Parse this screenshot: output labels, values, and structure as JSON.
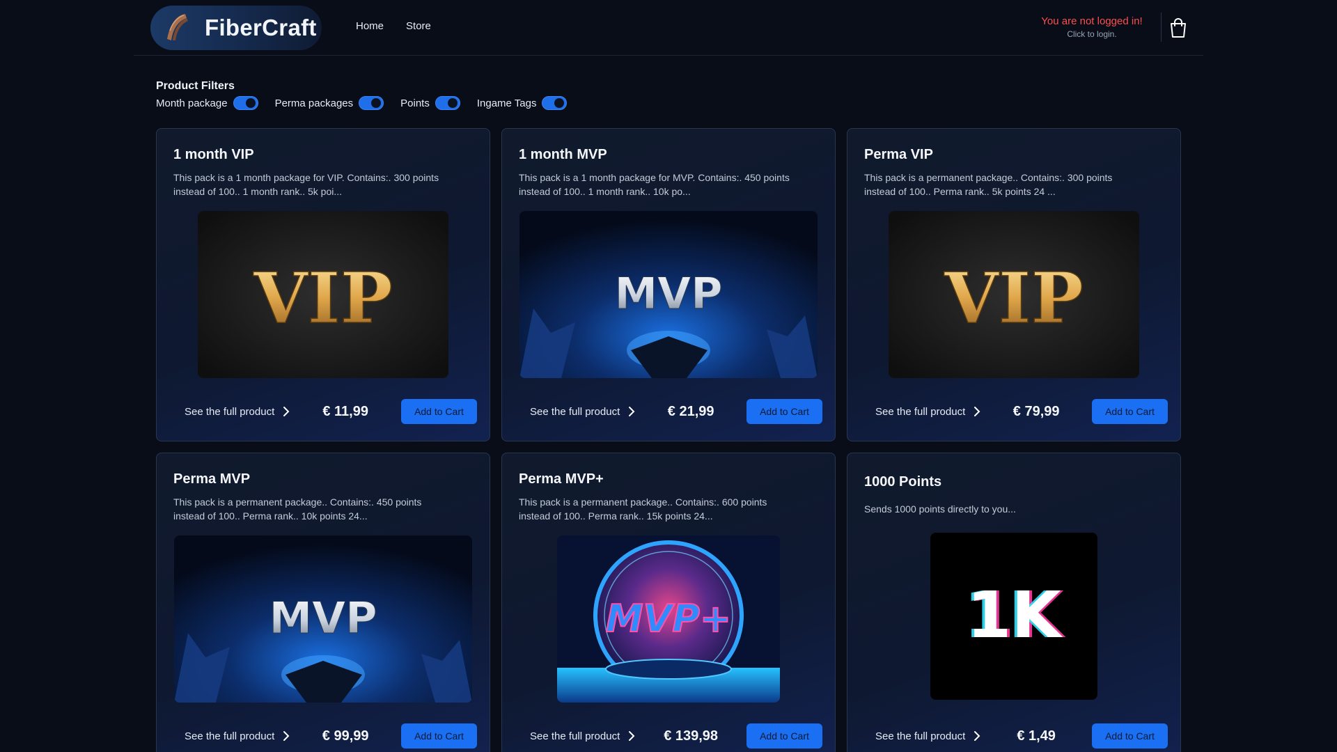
{
  "header": {
    "brand": "FiberCraft",
    "nav": [
      {
        "label": "Home"
      },
      {
        "label": "Store"
      }
    ],
    "login": {
      "title": "You are not logged in!",
      "subtitle": "Click to login."
    }
  },
  "filters": {
    "title": "Product Filters",
    "items": [
      {
        "label": "Month package",
        "enabled": true
      },
      {
        "label": "Perma packages",
        "enabled": true
      },
      {
        "label": "Points",
        "enabled": true
      },
      {
        "label": "Ingame Tags",
        "enabled": true
      }
    ]
  },
  "products": [
    {
      "title": "1 month VIP",
      "description": "This pack is a 1 month package for VIP. Contains:. 300 points instead of 100.. 1 month rank.. 5k poi...",
      "image_text": "VIP",
      "link_label": "See the full product",
      "price": "€ 11,99",
      "button": "Add to Cart"
    },
    {
      "title": "1 month MVP",
      "description": "This pack is a 1 month package for MVP. Contains:. 450 points instead of 100.. 1 month rank.. 10k po...",
      "image_text": "MVP",
      "link_label": "See the full product",
      "price": "€ 21,99",
      "button": "Add to Cart"
    },
    {
      "title": "Perma VIP",
      "description": "This pack is a permanent package.. Contains:. 300 points instead of 100.. Perma rank.. 5k points 24 ...",
      "image_text": "VIP",
      "link_label": "See the full product",
      "price": "€ 79,99",
      "button": "Add to Cart"
    },
    {
      "title": "Perma MVP",
      "description": "This pack is a permanent package.. Contains:. 450 points instead of 100.. Perma rank.. 10k points 24...",
      "image_text": "MVP",
      "link_label": "See the full product",
      "price": "€ 99,99",
      "button": "Add to Cart"
    },
    {
      "title": "Perma MVP+",
      "description": "This pack is a permanent package.. Contains:. 600 points instead of 100.. Perma rank.. 15k points 24...",
      "image_text": "MVP+",
      "link_label": "See the full product",
      "price": "€ 139,98",
      "button": "Add to Cart"
    },
    {
      "title": "1000 Points",
      "description": "Sends 1000 points directly to you...",
      "image_text": "1K",
      "link_label": "See the full product",
      "price": "€ 1,49",
      "button": "Add to Cart"
    }
  ],
  "colors": {
    "accent": "#1a6ff2",
    "warning": "#ff4d4d",
    "background": "#080d18"
  }
}
